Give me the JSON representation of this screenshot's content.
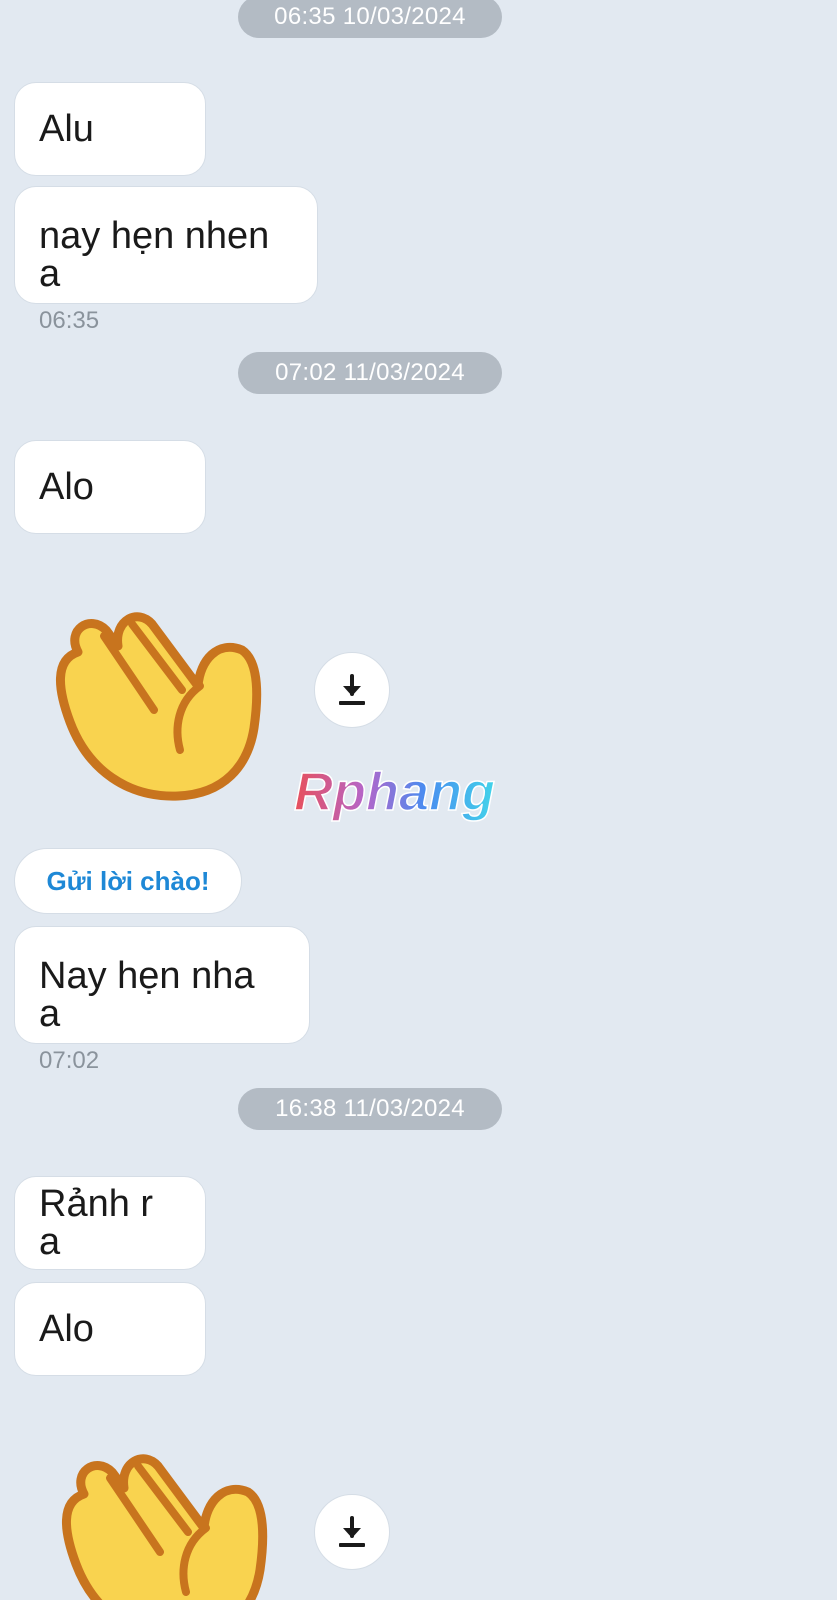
{
  "messages": {
    "ts1": "06:35 10/03/2024",
    "m1": "Alu",
    "m2": "nay hẹn nhen a",
    "m2_time": "06:35",
    "ts2": "07:02 11/03/2024",
    "m3": "Alo",
    "greet_button": "Gửi lời chào!",
    "m4": "Nay hẹn nha a",
    "m4_time": "07:02",
    "ts3": "16:38 11/03/2024",
    "m5": "Rảnh r a",
    "m6": "Alo"
  },
  "icons": {
    "sticker": "waving-hand-icon",
    "download": "download-icon"
  },
  "watermark": {
    "text": "Rphang"
  },
  "colors": {
    "background": "#e2e9f1",
    "bubble": "#ffffff",
    "timestamp_pill": "#b3bbc4",
    "accent_link": "#1e88d6",
    "hand_fill": "#f9d34f",
    "hand_outline": "#c8741e"
  }
}
